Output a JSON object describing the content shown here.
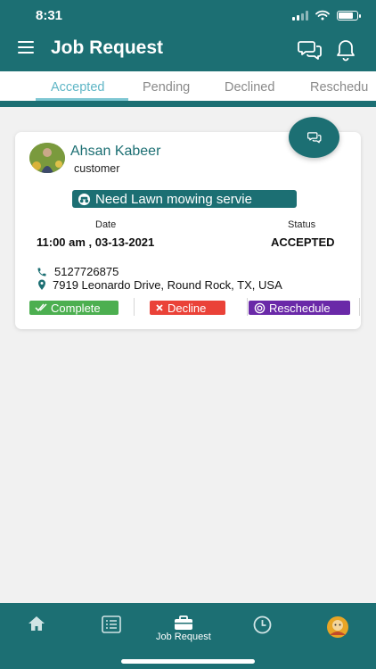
{
  "status_bar": {
    "time": "8:31"
  },
  "header": {
    "title": "Job Request"
  },
  "tabs": [
    {
      "label": "Accepted",
      "active": true
    },
    {
      "label": "Pending",
      "active": false
    },
    {
      "label": "Declined",
      "active": false
    },
    {
      "label": "Reschedu",
      "active": false
    }
  ],
  "job": {
    "customer_name": "Ahsan Kabeer",
    "customer_role": "customer",
    "service": "Need Lawn mowing servie",
    "date_label": "Date",
    "date_value": "11:00 am , 03-13-2021",
    "status_label": "Status",
    "status_value": "ACCEPTED",
    "phone": "5127726875",
    "address": "7919 Leonardo Drive, Round Rock, TX, USA",
    "actions": {
      "complete": "Complete",
      "decline": "Decline",
      "reschedule": "Reschedule"
    }
  },
  "bottom_nav": [
    {
      "icon": "home-icon",
      "label": ""
    },
    {
      "icon": "list-icon",
      "label": ""
    },
    {
      "icon": "briefcase-icon",
      "label": "Job Request"
    },
    {
      "icon": "clock-icon",
      "label": ""
    },
    {
      "icon": "profile-avatar-icon",
      "label": ""
    }
  ],
  "colors": {
    "primary": "#1c6f73",
    "tab_active": "#5fb6c6",
    "complete": "#4caf50",
    "decline": "#ea4238",
    "reschedule": "#6a29a8"
  }
}
